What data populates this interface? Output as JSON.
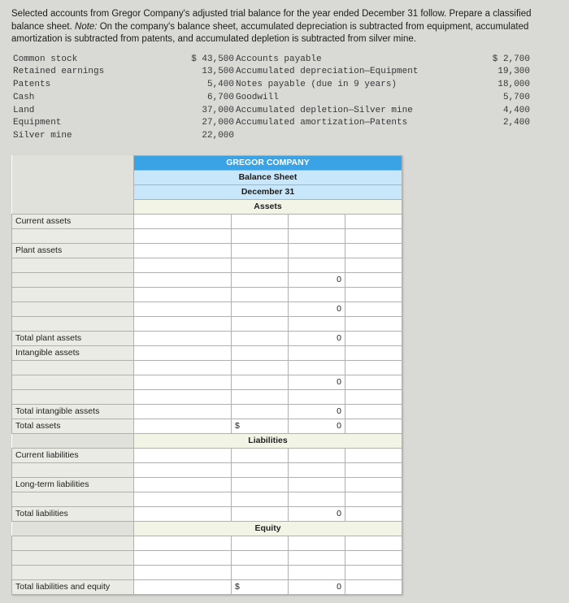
{
  "instructions": {
    "line1": "Selected accounts from Gregor Company's adjusted trial balance for the year ended December 31 follow. Prepare a classified balance sheet.",
    "note_label": "Note:",
    "note_text": " On the company's balance sheet, accumulated depreciation is subtracted from equipment, accumulated amortization is subtracted from patents, and accumulated depletion is subtracted from silver mine."
  },
  "trial_balance": {
    "left": [
      {
        "label": "Common stock",
        "amount": "$ 43,500"
      },
      {
        "label": "Retained earnings",
        "amount": "13,500"
      },
      {
        "label": "Patents",
        "amount": "5,400"
      },
      {
        "label": "Cash",
        "amount": "6,700"
      },
      {
        "label": "Land",
        "amount": "37,000"
      },
      {
        "label": "Equipment",
        "amount": "27,000"
      },
      {
        "label": "Silver mine",
        "amount": "22,000"
      }
    ],
    "right": [
      {
        "label": "Accounts payable",
        "amount": "$ 2,700"
      },
      {
        "label": "Accumulated depreciation—Equipment",
        "amount": "19,300"
      },
      {
        "label": "Notes payable (due in 9 years)",
        "amount": "18,000"
      },
      {
        "label": "Goodwill",
        "amount": "5,700"
      },
      {
        "label": "Accumulated depletion—Silver mine",
        "amount": "4,400"
      },
      {
        "label": "Accumulated amortization—Patents",
        "amount": "2,400"
      }
    ]
  },
  "sheet": {
    "company": "GREGOR COMPANY",
    "title": "Balance Sheet",
    "date": "December 31",
    "sections": {
      "assets": "Assets",
      "liabilities": "Liabilities",
      "equity": "Equity"
    },
    "rows": {
      "current_assets": "Current assets",
      "plant_assets": "Plant assets",
      "total_plant_assets": "Total plant assets",
      "intangible_assets": "Intangible assets",
      "total_intangible_assets": "Total intangible assets",
      "total_assets": "Total assets",
      "current_liabilities": "Current liabilities",
      "long_term_liabilities": "Long-term liabilities",
      "total_liabilities": "Total liabilities",
      "total_liab_equity": "Total liabilities and equity"
    },
    "symbols": {
      "dollar": "$"
    },
    "values": {
      "zero": "0"
    }
  }
}
